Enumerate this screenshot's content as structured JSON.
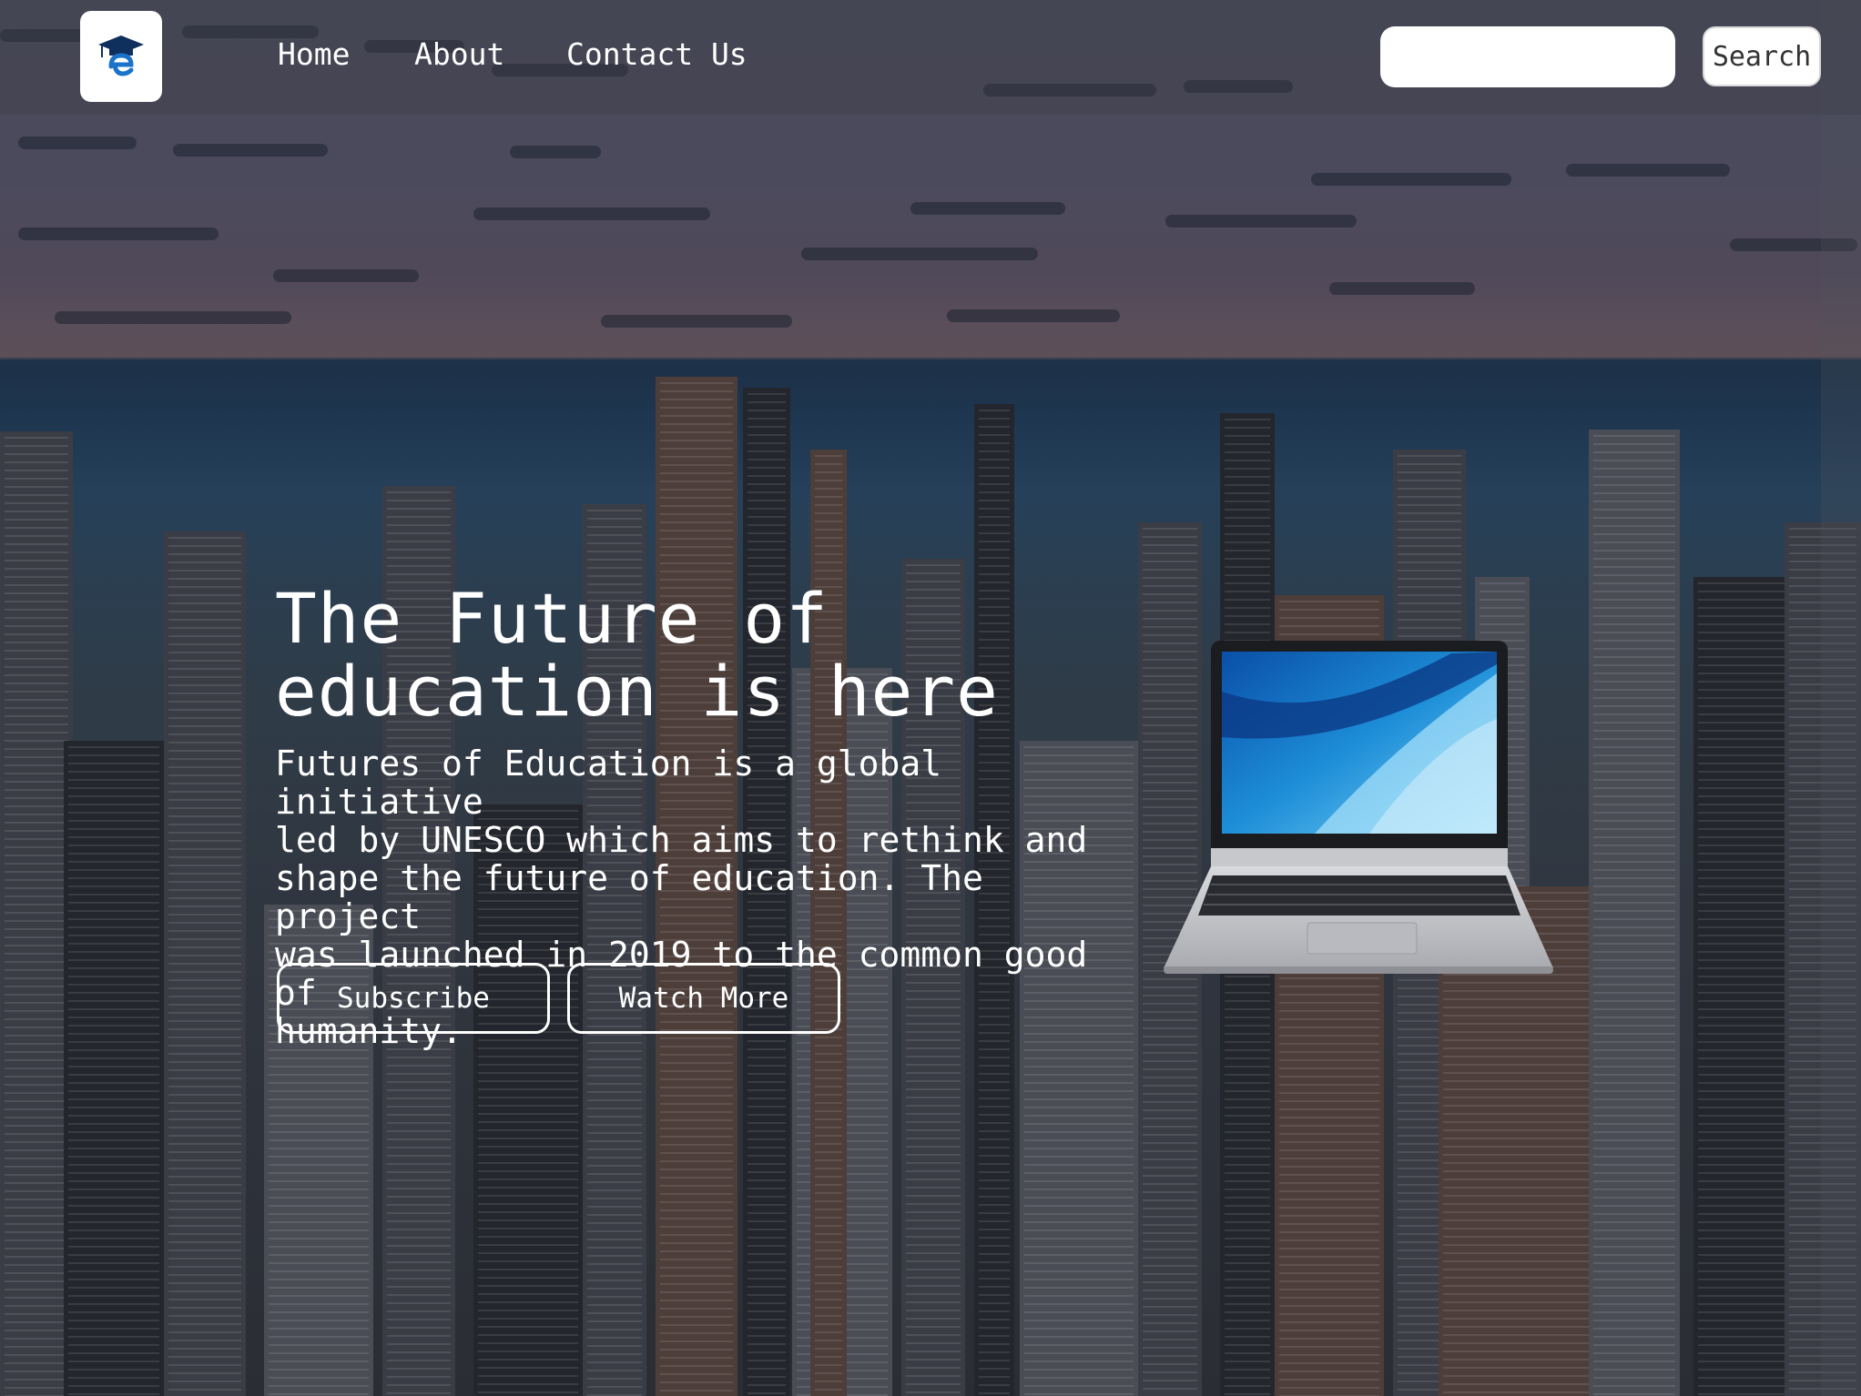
{
  "nav": {
    "logo_icon": "graduation-cap-e-icon",
    "links": [
      "Home",
      "About",
      "Contact Us"
    ],
    "search": {
      "placeholder": "",
      "value": "",
      "button_label": "Search"
    }
  },
  "hero": {
    "title_line1": "The Future of",
    "title_line2": "education is here",
    "description_lines": [
      "Futures of Education is a global initiative",
      "led by UNESCO which aims to rethink and",
      "shape the future of education. The project",
      "was launched in 2019 to the common good of",
      "humanity."
    ],
    "buttons": {
      "subscribe": "Subscribe",
      "watch_more": "Watch More"
    }
  },
  "media": {
    "background": "city-skyline-photo",
    "laptop_image": "laptop-image"
  },
  "colors": {
    "text": "#ffffff",
    "logo_blue": "#1a73c9",
    "cap_navy": "#0f2f5c"
  }
}
